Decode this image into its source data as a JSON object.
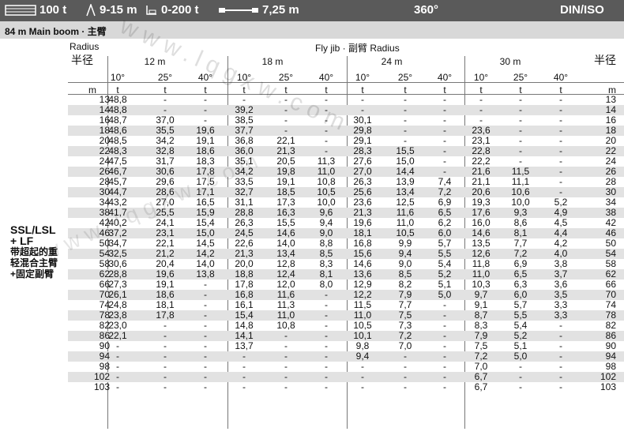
{
  "topbar": {
    "counterweight": "100 t",
    "superlift": "9-15 m",
    "sl_counterweight": "0-200 t",
    "width": "7,25 m",
    "slew": "360°",
    "standard": "DIN/ISO"
  },
  "subheader": "84 m  Main boom · 主臂",
  "side_label": {
    "line1": "SSL/LSL",
    "line2": "+ LF",
    "cn": [
      "带超起的重",
      "轻混合主臂",
      "+固定副臂"
    ]
  },
  "header": {
    "radius_left": "Radius",
    "radius_left_cn": "半径",
    "fly_jib": "Fly jib · 副臂 Radius",
    "radius_right_cn": "半径",
    "lengths": [
      "12 m",
      "18 m",
      "24 m",
      "30 m"
    ],
    "angles": [
      "10°",
      "25°",
      "40°",
      "10°",
      "25°",
      "40°",
      "10°",
      "25°",
      "40°",
      "10°",
      "25°",
      "40°"
    ],
    "units_left": "m",
    "units_t": "t",
    "units_right": "m"
  },
  "rows": [
    {
      "r": "13",
      "v": [
        "48,8",
        "-",
        "-",
        "-",
        "-",
        "-",
        "-",
        "-",
        "-",
        "-",
        "-",
        "-"
      ]
    },
    {
      "r": "14",
      "v": [
        "48,8",
        "-",
        "-",
        "39,2",
        "-",
        "-",
        "-",
        "-",
        "-",
        "-",
        "-",
        "-"
      ]
    },
    {
      "r": "16",
      "v": [
        "48,7",
        "37,0",
        "-",
        "38,5",
        "-",
        "-",
        "30,1",
        "-",
        "-",
        "-",
        "-",
        "-"
      ]
    },
    {
      "r": "18",
      "v": [
        "48,6",
        "35,5",
        "19,6",
        "37,7",
        "-",
        "-",
        "29,8",
        "-",
        "-",
        "23,6",
        "-",
        "-"
      ]
    },
    {
      "r": "20",
      "v": [
        "48,5",
        "34,2",
        "19,1",
        "36,8",
        "22,1",
        "-",
        "29,1",
        "-",
        "-",
        "23,1",
        "-",
        "-"
      ]
    },
    {
      "r": "22",
      "v": [
        "48,3",
        "32,8",
        "18,6",
        "36,0",
        "21,3",
        "-",
        "28,3",
        "15,5",
        "-",
        "22,8",
        "-",
        "-"
      ]
    },
    {
      "r": "24",
      "v": [
        "47,5",
        "31,7",
        "18,3",
        "35,1",
        "20,5",
        "11,3",
        "27,6",
        "15,0",
        "-",
        "22,2",
        "-",
        "-"
      ]
    },
    {
      "r": "26",
      "v": [
        "46,7",
        "30,6",
        "17,8",
        "34,2",
        "19,8",
        "11,0",
        "27,0",
        "14,4",
        "-",
        "21,6",
        "11,5",
        "-"
      ]
    },
    {
      "r": "28",
      "v": [
        "45,7",
        "29,6",
        "17,5",
        "33,5",
        "19,1",
        "10,8",
        "26,3",
        "13,9",
        "7,4",
        "21,1",
        "11,1",
        "-"
      ]
    },
    {
      "r": "30",
      "v": [
        "44,7",
        "28,6",
        "17,1",
        "32,7",
        "18,5",
        "10,5",
        "25,6",
        "13,4",
        "7,2",
        "20,6",
        "10,6",
        "-"
      ]
    },
    {
      "r": "34",
      "v": [
        "43,2",
        "27,0",
        "16,5",
        "31,1",
        "17,3",
        "10,0",
        "23,6",
        "12,5",
        "6,9",
        "19,3",
        "10,0",
        "5,2"
      ]
    },
    {
      "r": "38",
      "v": [
        "41,7",
        "25,5",
        "15,9",
        "28,8",
        "16,3",
        "9,6",
        "21,3",
        "11,6",
        "6,5",
        "17,6",
        "9,3",
        "4,9"
      ]
    },
    {
      "r": "42",
      "v": [
        "40,2",
        "24,1",
        "15,4",
        "26,3",
        "15,5",
        "9,4",
        "19,6",
        "11,0",
        "6,2",
        "16,0",
        "8,6",
        "4,5"
      ]
    },
    {
      "r": "46",
      "v": [
        "37,2",
        "23,1",
        "15,0",
        "24,5",
        "14,6",
        "9,0",
        "18,1",
        "10,5",
        "6,0",
        "14,6",
        "8,1",
        "4,4"
      ]
    },
    {
      "r": "50",
      "v": [
        "34,7",
        "22,1",
        "14,5",
        "22,6",
        "14,0",
        "8,8",
        "16,8",
        "9,9",
        "5,7",
        "13,5",
        "7,7",
        "4,2"
      ]
    },
    {
      "r": "54",
      "v": [
        "32,5",
        "21,2",
        "14,2",
        "21,3",
        "13,4",
        "8,5",
        "15,6",
        "9,4",
        "5,5",
        "12,6",
        "7,2",
        "4,0"
      ]
    },
    {
      "r": "58",
      "v": [
        "30,6",
        "20,4",
        "14,0",
        "20,0",
        "12,8",
        "8,3",
        "14,6",
        "9,0",
        "5,4",
        "11,8",
        "6,9",
        "3,8"
      ]
    },
    {
      "r": "62",
      "v": [
        "28,8",
        "19,6",
        "13,8",
        "18,8",
        "12,4",
        "8,1",
        "13,6",
        "8,5",
        "5,2",
        "11,0",
        "6,5",
        "3,7"
      ]
    },
    {
      "r": "66",
      "v": [
        "27,3",
        "19,1",
        "-",
        "17,8",
        "12,0",
        "8,0",
        "12,9",
        "8,2",
        "5,1",
        "10,3",
        "6,3",
        "3,6"
      ]
    },
    {
      "r": "70",
      "v": [
        "26,1",
        "18,6",
        "-",
        "16,8",
        "11,6",
        "-",
        "12,2",
        "7,9",
        "5,0",
        "9,7",
        "6,0",
        "3,5"
      ]
    },
    {
      "r": "74",
      "v": [
        "24,8",
        "18,1",
        "-",
        "16,1",
        "11,3",
        "-",
        "11,5",
        "7,7",
        "-",
        "9,1",
        "5,7",
        "3,3"
      ]
    },
    {
      "r": "78",
      "v": [
        "23,8",
        "17,8",
        "-",
        "15,4",
        "11,0",
        "-",
        "11,0",
        "7,5",
        "-",
        "8,7",
        "5,5",
        "3,3"
      ]
    },
    {
      "r": "82",
      "v": [
        "23,0",
        "-",
        "-",
        "14,8",
        "10,8",
        "-",
        "10,5",
        "7,3",
        "-",
        "8,3",
        "5,4",
        "-"
      ]
    },
    {
      "r": "86",
      "v": [
        "22,1",
        "-",
        "-",
        "14,1",
        "-",
        "-",
        "10,1",
        "7,2",
        "-",
        "7,9",
        "5,2",
        "-"
      ]
    },
    {
      "r": "90",
      "v": [
        "-",
        "-",
        "-",
        "13,7",
        "-",
        "-",
        "9,8",
        "7,0",
        "-",
        "7,5",
        "5,1",
        "-"
      ]
    },
    {
      "r": "94",
      "v": [
        "-",
        "-",
        "-",
        "-",
        "-",
        "-",
        "9,4",
        "-",
        "-",
        "7,2",
        "5,0",
        "-"
      ]
    },
    {
      "r": "98",
      "v": [
        "-",
        "-",
        "-",
        "-",
        "-",
        "-",
        "-",
        "-",
        "-",
        "7,0",
        "-",
        "-"
      ]
    },
    {
      "r": "102",
      "v": [
        "-",
        "-",
        "-",
        "-",
        "-",
        "-",
        "-",
        "-",
        "-",
        "6,7",
        "-",
        "-"
      ]
    },
    {
      "r": "103",
      "v": [
        "-",
        "-",
        "-",
        "-",
        "-",
        "-",
        "-",
        "-",
        "-",
        "6,7",
        "-",
        "-"
      ]
    }
  ],
  "watermark": "www.lqgxw.com"
}
